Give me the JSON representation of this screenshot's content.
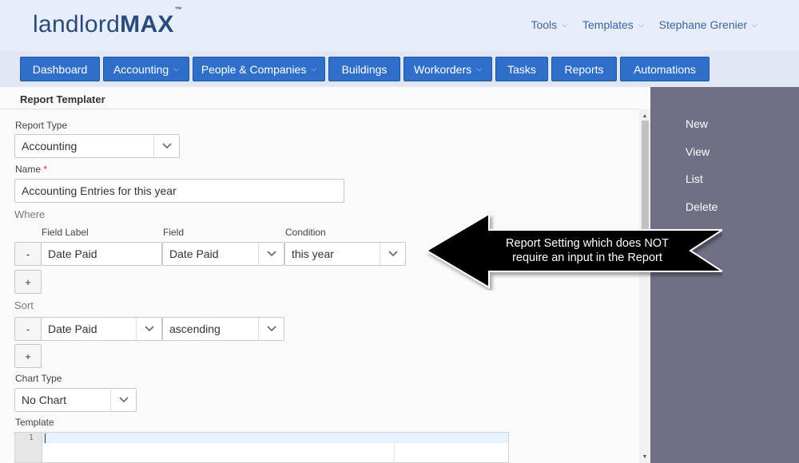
{
  "header": {
    "logo_light": "landlord",
    "logo_bold": "MAX",
    "logo_tm": "™",
    "menu": [
      {
        "label": "Tools"
      },
      {
        "label": "Templates"
      },
      {
        "label": "Stephane Grenier"
      }
    ]
  },
  "nav": {
    "items": [
      {
        "label": "Dashboard",
        "dropdown": false
      },
      {
        "label": "Accounting",
        "dropdown": true
      },
      {
        "label": "People & Companies",
        "dropdown": true
      },
      {
        "label": "Buildings",
        "dropdown": false
      },
      {
        "label": "Workorders",
        "dropdown": true
      },
      {
        "label": "Tasks",
        "dropdown": false
      },
      {
        "label": "Reports",
        "dropdown": false
      },
      {
        "label": "Automations",
        "dropdown": false
      }
    ]
  },
  "page": {
    "title": "Report Templater",
    "report_type": {
      "label": "Report Type",
      "value": "Accounting"
    },
    "name": {
      "label": "Name",
      "required_mark": "*",
      "value": "Accounting Entries for this year"
    },
    "where": {
      "title": "Where",
      "col_field_label": "Field Label",
      "col_field": "Field",
      "col_condition": "Condition",
      "row": {
        "remove": "-",
        "field_label": "Date Paid",
        "field": "Date Paid",
        "condition": "this year"
      },
      "add": "+"
    },
    "sort": {
      "title": "Sort",
      "row": {
        "remove": "-",
        "field": "Date Paid",
        "direction": "ascending"
      },
      "add": "+"
    },
    "chart_type": {
      "label": "Chart Type",
      "value": "No Chart"
    },
    "template": {
      "label": "Template",
      "line_number": "1"
    }
  },
  "sidebar": {
    "items": [
      {
        "label": "New"
      },
      {
        "label": "View"
      },
      {
        "label": "List"
      },
      {
        "label": "Delete"
      }
    ]
  },
  "callout": {
    "line1": "Report Setting which does NOT",
    "line2": "require an input in the Report"
  },
  "colors": {
    "nav_button": "#2f6fc9",
    "sidebar": "#6f6f86",
    "header_bg": "#e8eef9",
    "callout": "#000000"
  }
}
